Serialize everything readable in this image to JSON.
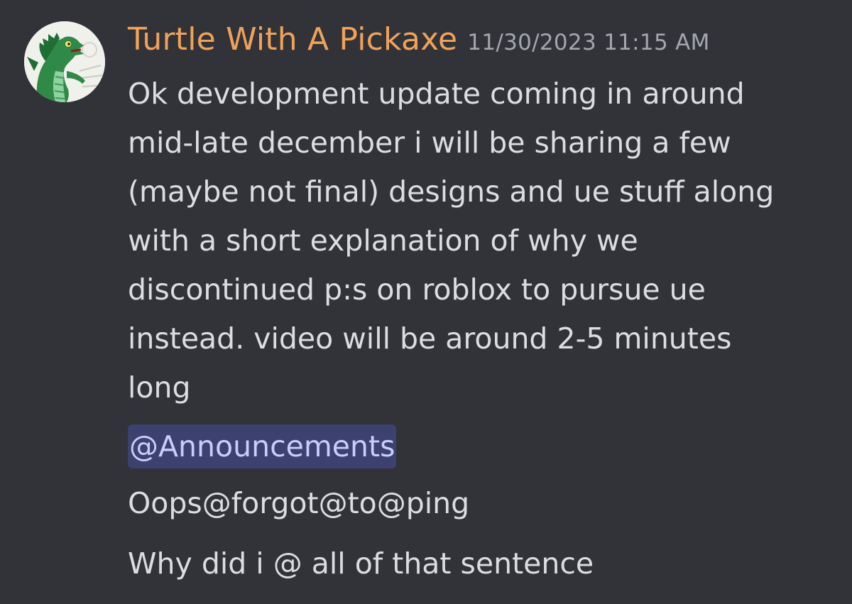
{
  "message": {
    "author": "Turtle With A Pickaxe",
    "timestamp": "11/30/2023 11:15 AM",
    "author_color": "#f0a258",
    "avatar_icon": "green-dragon-avatar",
    "body_lines": [
      "Ok development update coming in around",
      "mid-late december i will be sharing a few",
      "(maybe not final) designs and ue stuff along",
      "with a short explanation of why we",
      "discontinued p:s on roblox to pursue ue",
      "instead. video will be around 2-5 minutes",
      "long"
    ]
  },
  "mention": {
    "label": "@Announcements",
    "bg_color": "#3c4170",
    "text_color": "#c9cdfb"
  },
  "followups": [
    "Oops@forgot@to@ping",
    "Why did i @ all of that sentence"
  ]
}
